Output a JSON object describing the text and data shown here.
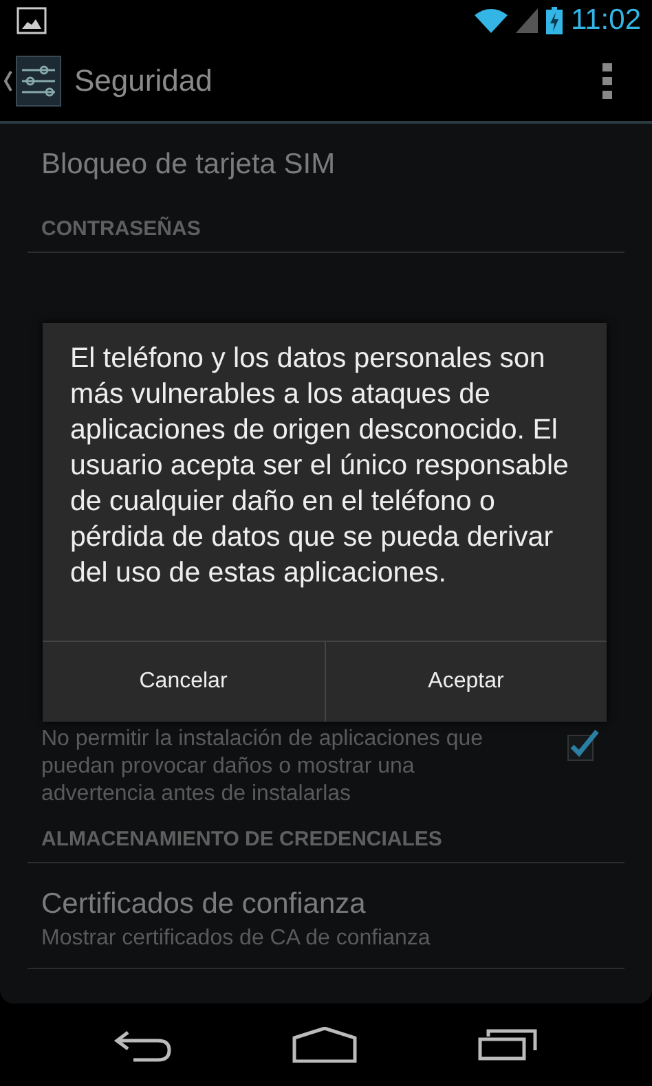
{
  "status_bar": {
    "time": "11:02"
  },
  "action_bar": {
    "title": "Seguridad"
  },
  "list": [
    {
      "kind": "item",
      "title": "Bloqueo de tarjeta SIM"
    },
    {
      "kind": "header",
      "title": "CONTRASEÑAS"
    },
    {
      "kind": "check",
      "summary": "No permitir la instalación de aplicaciones que puedan provocar daños o mostrar una advertencia antes de instalarlas",
      "checked": true
    },
    {
      "kind": "header",
      "title": "ALMACENAMIENTO DE CREDENCIALES"
    },
    {
      "kind": "item",
      "title": "Certificados de confianza",
      "summary": "Mostrar certificados de CA de confianza"
    }
  ],
  "dialog": {
    "message": "El teléfono y los datos personales son más vulnerables a los ataques de aplicaciones de origen desconocido. El usuario acepta ser el único responsable de cualquier daño en el teléfono o pérdida de datos que se pueda derivar del uso de estas aplicaciones.",
    "buttons": [
      {
        "label": "Cancelar"
      },
      {
        "label": "Aceptar"
      }
    ]
  }
}
